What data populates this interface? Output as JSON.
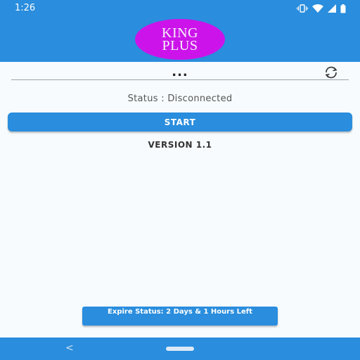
{
  "status_bar": {
    "time": "1:26",
    "icons": [
      "vibrate-icon",
      "wifi-icon",
      "signal-icon",
      "battery-icon"
    ]
  },
  "header": {
    "logo_line1": "KING",
    "logo_line2": "PLUS"
  },
  "server": {
    "value": "...",
    "refresh_icon": "refresh-icon"
  },
  "connection": {
    "status_text": "Status : Disconnected"
  },
  "actions": {
    "start_label": "START"
  },
  "app": {
    "version": "VERSION 1.1"
  },
  "expire": {
    "label": "Expire Status: 2 Days & 1 Hours Left"
  },
  "nav": {
    "back_glyph": "<"
  },
  "colors": {
    "primary": "#2a8ddd",
    "logo_bg": "#cc14ea",
    "background": "#f7fbfe"
  }
}
